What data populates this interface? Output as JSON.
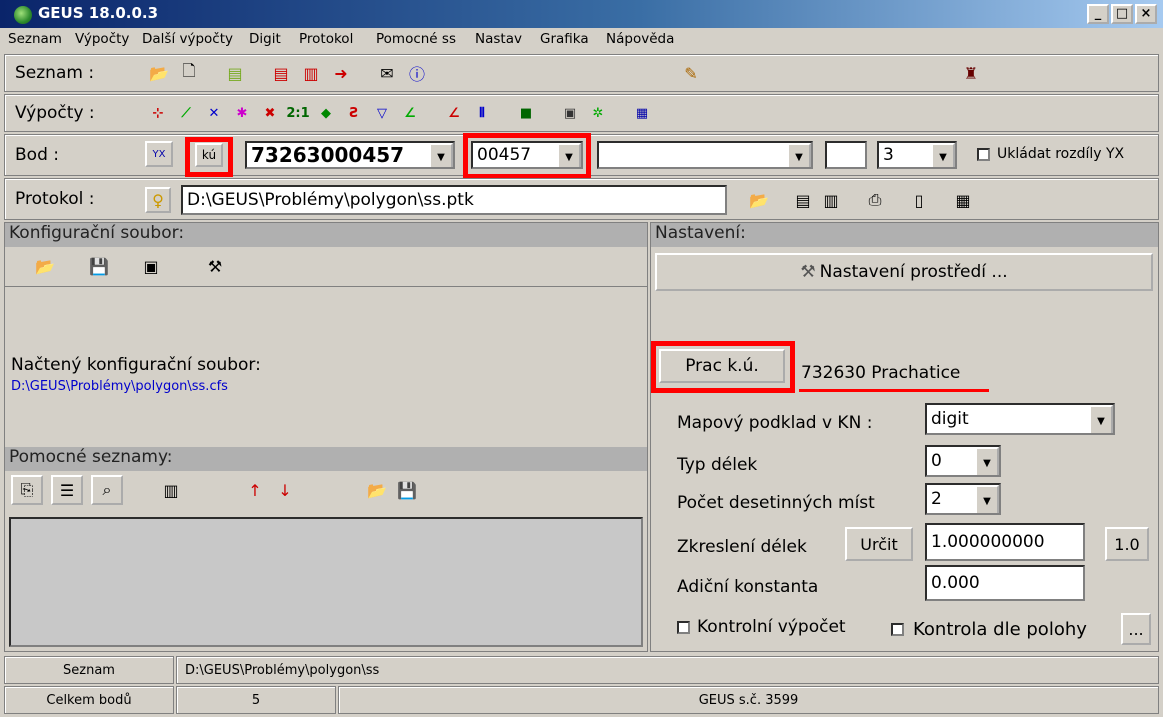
{
  "window": {
    "title": "GEUS 18.0.0.3",
    "minimize": "_",
    "maximize": "□",
    "close": "×"
  },
  "menu": [
    "Seznam",
    "Výpočty",
    "Další výpočty",
    "Digit",
    "Protokol",
    "Pomocné ss",
    "Nastav",
    "Grafika",
    "Nápověda"
  ],
  "rows": {
    "seznam_label": "Seznam :",
    "vypocty_label": "Výpočty :",
    "bod_label": "Bod :",
    "protokol_label": "Protokol :"
  },
  "bod": {
    "ku_label": "kú",
    "yx_label": "YX",
    "point_number": "73263000457",
    "short_number": "00457",
    "third_value": "",
    "small_value": "",
    "digits": "3",
    "ukladat_label": "Ukládat rozdíly YX"
  },
  "protokol": {
    "path": "D:\\GEUS\\Problémy\\polygon\\ss.ptk"
  },
  "config": {
    "header": "Konfigurační soubor:",
    "loaded_label": "Načtený konfigurační soubor:",
    "loaded_path": "D:\\GEUS\\Problémy\\polygon\\ss.cfs"
  },
  "pomocne": {
    "header": "Pomocné seznamy:"
  },
  "nastaveni": {
    "header": "Nastavení:",
    "env_button": "Nastavení prostředí ...",
    "prac_button": "Prac k.ú.",
    "prac_value": "732630  Prachatice",
    "mapovy_label": "Mapový podklad v KN :",
    "mapovy_value": "digit",
    "typ_label": "Typ délek",
    "typ_value": "0",
    "pocet_label": "Počet desetinných míst",
    "pocet_value": "2",
    "zkresleni_label": "Zkreslení délek",
    "urcit_button": "Určit",
    "zkresleni_value": "1.000000000",
    "one_button": "1.0",
    "adicni_label": "Adiční konstanta",
    "adicni_value": "0.000",
    "kontrolni_label": "Kontrolní výpočet",
    "kontrola_label": "Kontrola dle polohy",
    "dots_button": "..."
  },
  "status": {
    "seznam_label": "Seznam",
    "seznam_path": "D:\\GEUS\\Problémy\\polygon\\ss",
    "celkem_label": "Celkem bodů",
    "celkem_value": "5",
    "geus_sc": "GEUS s.č. 3599"
  },
  "colors": {
    "title_start": "#0a246a",
    "title_end": "#a6caf0",
    "highlight": "#ff0000",
    "link": "#0000cc"
  },
  "icons": {
    "seznam_row": [
      "open-folder-icon",
      "new-file-icon",
      "doc-icon",
      "doc-red-icon",
      "doc-copy-icon",
      "doc-arrow-icon",
      "printer-mail-icon",
      "info-icon",
      "edit-icon",
      "person-icon"
    ],
    "vypocty_row": [
      "calc1-icon",
      "calc2-icon",
      "calc3-icon",
      "calc4-icon",
      "calc5-icon",
      "calc6-icon",
      "calc7-icon",
      "calc8-icon",
      "calc9-icon",
      "calc10-icon",
      "calc11-icon",
      "calc12-icon",
      "calc13-icon",
      "calc14-icon",
      "calc15-icon",
      "calc16-icon"
    ]
  }
}
